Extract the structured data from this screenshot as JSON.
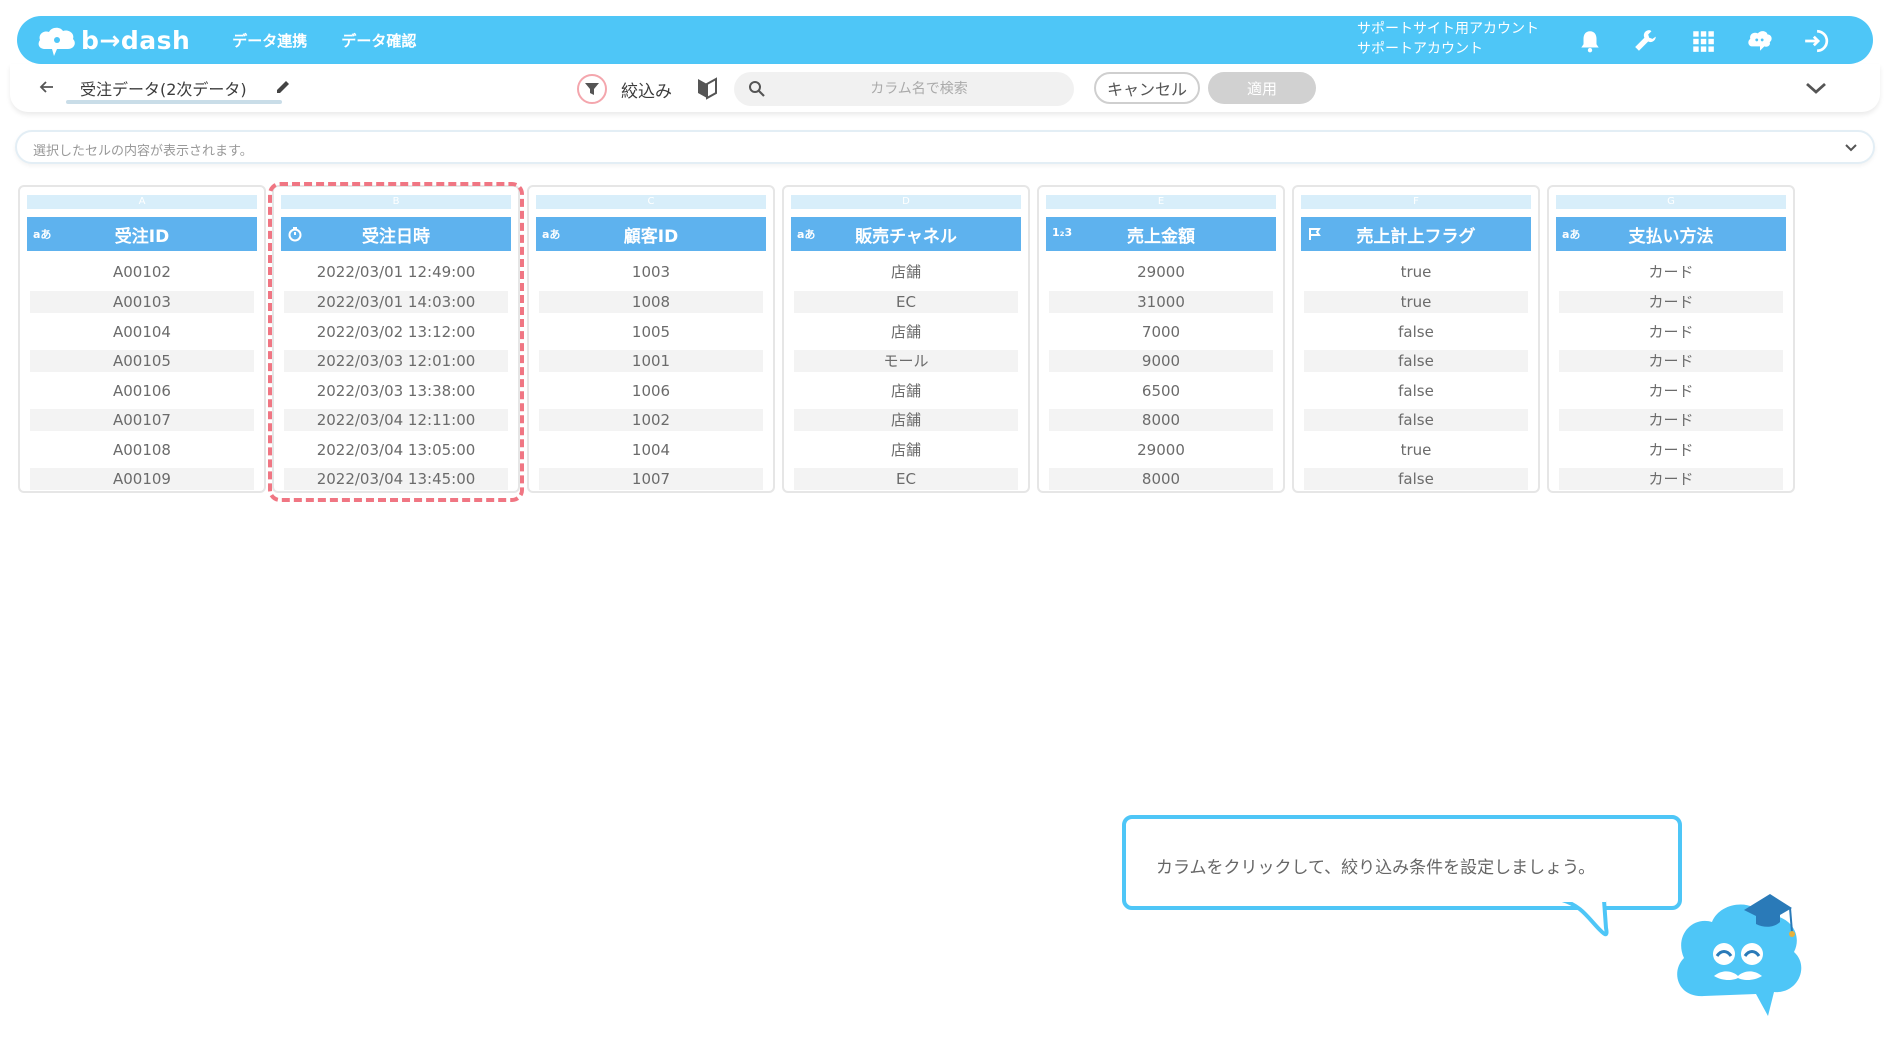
{
  "header": {
    "logo_text": "b→dash",
    "nav": [
      "データ連携",
      "データ確認"
    ],
    "account_line1": "サポートサイト用アカウント",
    "account_line2": "サポートアカウント",
    "icons": [
      "bell-icon",
      "wrench-icon",
      "grid-icon",
      "chat-icon",
      "logout-icon"
    ]
  },
  "toolbar": {
    "dataset_name": "受注データ(2次データ)",
    "filter_label": "絞込み",
    "search_placeholder": "カラム名で検索",
    "cancel_label": "キャンセル",
    "apply_label": "適用"
  },
  "cell_bar": {
    "placeholder": "選択したセルの内容が表示されます。"
  },
  "table": {
    "columns": [
      {
        "letter": "A",
        "type_label": "aあ",
        "name": "受注ID",
        "values": [
          "A00102",
          "A00103",
          "A00104",
          "A00105",
          "A00106",
          "A00107",
          "A00108",
          "A00109"
        ]
      },
      {
        "letter": "B",
        "type_label": "",
        "name": "受注日時",
        "values": [
          "2022/03/01 12:49:00",
          "2022/03/01 14:03:00",
          "2022/03/02 13:12:00",
          "2022/03/03 12:01:00",
          "2022/03/03 13:38:00",
          "2022/03/04 12:11:00",
          "2022/03/04 13:05:00",
          "2022/03/04 13:45:00"
        ]
      },
      {
        "letter": "C",
        "type_label": "aあ",
        "name": "顧客ID",
        "values": [
          "1003",
          "1008",
          "1005",
          "1001",
          "1006",
          "1002",
          "1004",
          "1007"
        ]
      },
      {
        "letter": "D",
        "type_label": "aあ",
        "name": "販売チャネル",
        "values": [
          "店舗",
          "EC",
          "店舗",
          "モール",
          "店舗",
          "店舗",
          "店舗",
          "EC"
        ]
      },
      {
        "letter": "E",
        "type_label": "1₂3",
        "name": "売上金額",
        "values": [
          "29000",
          "31000",
          "7000",
          "9000",
          "6500",
          "8000",
          "29000",
          "8000"
        ]
      },
      {
        "letter": "F",
        "type_label": "",
        "name": "売上計上フラグ",
        "values": [
          "true",
          "true",
          "false",
          "false",
          "false",
          "false",
          "true",
          "false"
        ]
      },
      {
        "letter": "G",
        "type_label": "aあ",
        "name": "支払い方法",
        "values": [
          "カード",
          "カード",
          "カード",
          "カード",
          "カード",
          "カード",
          "カード",
          "カード"
        ]
      }
    ]
  },
  "tutorial": {
    "message": "カラムをクリックして、絞り込み条件を設定しましょう。"
  },
  "colors": {
    "brand": "#4ec6f7",
    "header_cell": "#5eb2ee",
    "highlight": "#f07683"
  }
}
